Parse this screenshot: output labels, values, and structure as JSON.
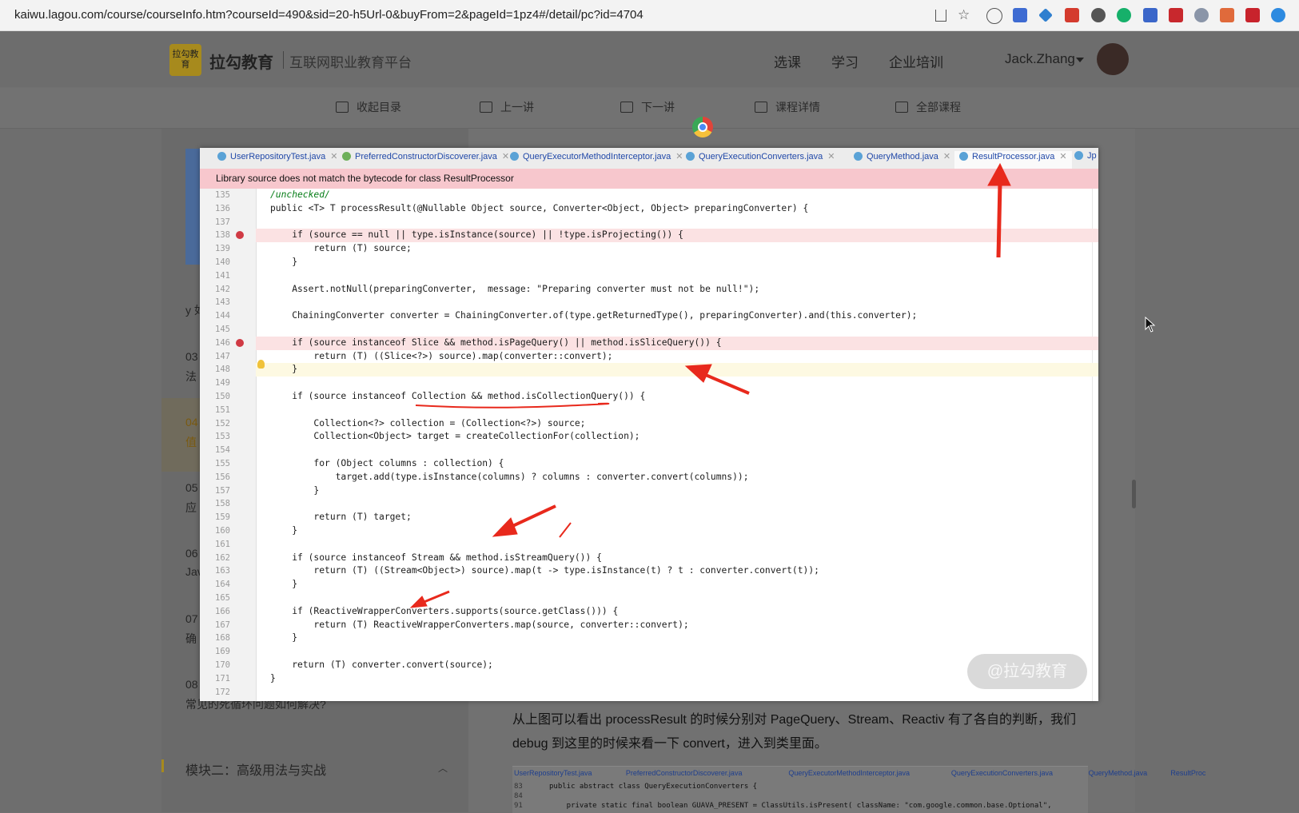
{
  "browser": {
    "url": "kaiwu.lagou.com/course/courseInfo.htm?courseId=490&sid=20-h5Url-0&buyFrom=2&pageId=1pz4#/detail/pc?id=4704"
  },
  "site": {
    "logo_text": "拉勾教育",
    "logo_badge": "拉勾教育",
    "tagline": "互联网职业教育平台",
    "nav": [
      "选课",
      "学习",
      "企业培训"
    ],
    "user": "Jack.Zhang"
  },
  "subnav": [
    "收起目录",
    "上一讲",
    "下一讲",
    "课程详情",
    "全部课程"
  ],
  "sidebar": {
    "fragments": [
      "y 如",
      "03",
      "法",
      "04",
      "值",
      "05",
      "应",
      "06",
      "Jav",
      "07",
      "确",
      "08"
    ],
    "last_item": "常见的死循环问题如何解决?",
    "module_title": "模块二：高级用法与实战"
  },
  "ide": {
    "tabs": [
      "UserRepositoryTest.java",
      "PreferredConstructorDiscoverer.java",
      "QueryExecutorMethodInterceptor.java",
      "QueryExecutionConverters.java",
      "QueryMethod.java",
      "ResultProcessor.java",
      "Jp"
    ],
    "active_tab": "ResultProcessor.java",
    "warning": "Library source does not match the bytecode for class ResultProcessor",
    "lines": [
      {
        "n": "135",
        "text": "/unchecked/"
      },
      {
        "n": "136",
        "text": "public <T> T processResult(@Nullable Object source, Converter<Object, Object> preparingConverter) {"
      },
      {
        "n": "137",
        "text": ""
      },
      {
        "n": "138",
        "text": "    if (source == null || type.isInstance(source) || !type.isProjecting()) {"
      },
      {
        "n": "139",
        "text": "        return (T) source;"
      },
      {
        "n": "140",
        "text": "    }"
      },
      {
        "n": "141",
        "text": ""
      },
      {
        "n": "142",
        "text": "    Assert.notNull(preparingConverter,  message: \"Preparing converter must not be null!\");"
      },
      {
        "n": "143",
        "text": ""
      },
      {
        "n": "144",
        "text": "    ChainingConverter converter = ChainingConverter.of(type.getReturnedType(), preparingConverter).and(this.converter);"
      },
      {
        "n": "145",
        "text": ""
      },
      {
        "n": "146",
        "text": "    if (source instanceof Slice && method.isPageQuery() || method.isSliceQuery()) {"
      },
      {
        "n": "147",
        "text": "        return (T) ((Slice<?>) source).map(converter::convert);"
      },
      {
        "n": "148",
        "text": "    }"
      },
      {
        "n": "149",
        "text": ""
      },
      {
        "n": "150",
        "text": "    if (source instanceof Collection && method.isCollectionQuery()) {"
      },
      {
        "n": "151",
        "text": ""
      },
      {
        "n": "152",
        "text": "        Collection<?> collection = (Collection<?>) source;"
      },
      {
        "n": "153",
        "text": "        Collection<Object> target = createCollectionFor(collection);"
      },
      {
        "n": "154",
        "text": ""
      },
      {
        "n": "155",
        "text": "        for (Object columns : collection) {"
      },
      {
        "n": "156",
        "text": "            target.add(type.isInstance(columns) ? columns : converter.convert(columns));"
      },
      {
        "n": "157",
        "text": "        }"
      },
      {
        "n": "158",
        "text": ""
      },
      {
        "n": "159",
        "text": "        return (T) target;"
      },
      {
        "n": "160",
        "text": "    }"
      },
      {
        "n": "161",
        "text": ""
      },
      {
        "n": "162",
        "text": "    if (source instanceof Stream && method.isStreamQuery()) {"
      },
      {
        "n": "163",
        "text": "        return (T) ((Stream<Object>) source).map(t -> type.isInstance(t) ? t : converter.convert(t));"
      },
      {
        "n": "164",
        "text": "    }"
      },
      {
        "n": "165",
        "text": ""
      },
      {
        "n": "166",
        "text": "    if (ReactiveWrapperConverters.supports(source.getClass())) {"
      },
      {
        "n": "167",
        "text": "        return (T) ReactiveWrapperConverters.map(source, converter::convert);"
      },
      {
        "n": "168",
        "text": "    }"
      },
      {
        "n": "169",
        "text": ""
      },
      {
        "n": "170",
        "text": "    return (T) converter.convert(source);"
      },
      {
        "n": "171",
        "text": "}"
      },
      {
        "n": "172",
        "text": ""
      }
    ],
    "watermark": "@拉勾教育"
  },
  "article": {
    "paragraph": "从上图可以看出 processResult 的时候分别对 PageQuery、Stream、Reactiv 有了各自的判断，我们 debug 到这里的时候来看一下 convert，进入到类里面。",
    "thumb_tabs": [
      "UserRepositoryTest.java",
      "PreferredConstructorDiscoverer.java",
      "QueryExecutorMethodInterceptor.java",
      "QueryExecutionConverters.java",
      "QueryMethod.java",
      "ResultProc"
    ],
    "thumb_lines": [
      {
        "n": "83",
        "text": "public abstract class QueryExecutionConverters {"
      },
      {
        "n": "84",
        "text": ""
      },
      {
        "n": "91",
        "text": "    private static final boolean GUAVA_PRESENT = ClassUtils.isPresent( className: \"com.google.common.base.Optional\","
      }
    ]
  },
  "colors": {
    "accent_arrow": "#e8291c",
    "warning_bg": "#f7c7cd",
    "keyword": "#00007f",
    "string": "#067d17"
  }
}
